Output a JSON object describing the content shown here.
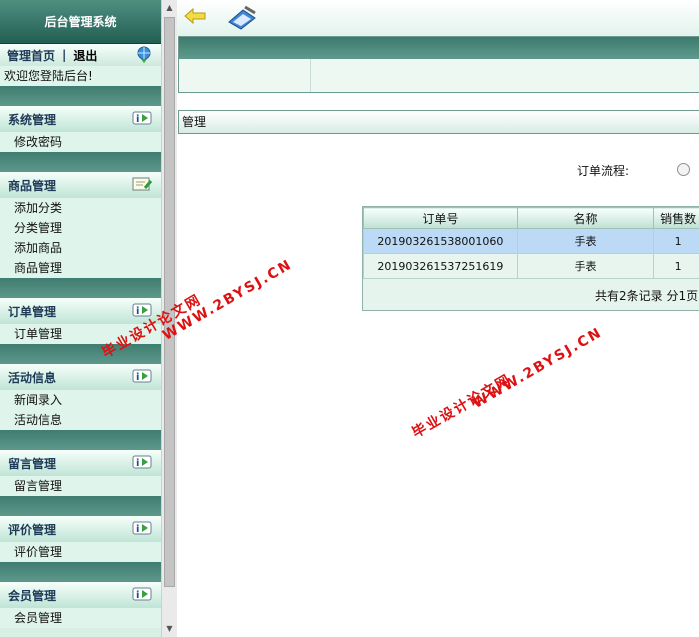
{
  "sidebar": {
    "title": "后台管理系统",
    "home_link": "管理首页",
    "separator": "|",
    "logout_link": "退出",
    "welcome": "欢迎您登陆后台!",
    "sections": [
      {
        "heading": "系统管理",
        "icon": "info-tag-icon",
        "items": [
          "修改密码"
        ]
      },
      {
        "heading": "商品管理",
        "icon": "note-edit-icon",
        "items": [
          "添加分类",
          "分类管理",
          "添加商品",
          "商品管理"
        ]
      },
      {
        "heading": "订单管理",
        "icon": "info-tag-icon",
        "items": [
          "订单管理"
        ]
      },
      {
        "heading": "活动信息",
        "icon": "info-tag-icon",
        "items": [
          "新闻录入",
          "活动信息"
        ]
      },
      {
        "heading": "留言管理",
        "icon": "info-tag-icon",
        "items": [
          "留言管理"
        ]
      },
      {
        "heading": "评价管理",
        "icon": "info-tag-icon",
        "items": [
          "评价管理"
        ]
      },
      {
        "heading": "会员管理",
        "icon": "info-tag-icon",
        "items": [
          "会员管理"
        ]
      }
    ]
  },
  "main": {
    "panel_title": "管理",
    "flow_label": "订单流程:",
    "table": {
      "headers": [
        "订单号",
        "名称",
        "销售数"
      ],
      "rows": [
        [
          "201903261538001060",
          "手表",
          "1"
        ],
        [
          "201903261537251619",
          "手表",
          "1"
        ]
      ],
      "pager": "共有2条记录  分1页"
    }
  },
  "watermark": {
    "text1": "毕业设计论文网",
    "text2": "WWW.2BYSJ.CN"
  },
  "colors": {
    "accent_dark": "#215f53",
    "accent_band": "#3f7d70",
    "sidebar_bg": "#d8efe4",
    "selected_row": "#bcd9f6",
    "watermark": "#dd1111"
  }
}
